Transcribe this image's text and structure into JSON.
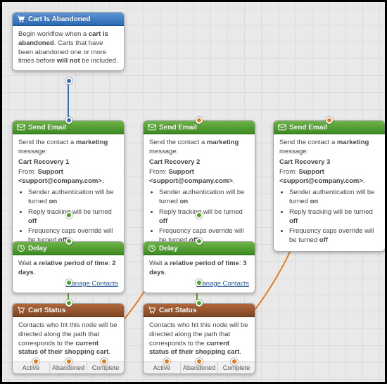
{
  "nodes": {
    "trigger": {
      "title": "Cart Is Abandoned",
      "body_parts": [
        "Begin workflow when a ",
        "cart is abandoned",
        ". Carts that have been abandoned one or more times before ",
        "will not",
        " be included."
      ]
    },
    "email1": {
      "title": "Send Email",
      "intro_pre": "Send the contact a ",
      "intro_bold": "marketing",
      "intro_post": " message:",
      "name": "Cart Recovery 1",
      "from_label": "From: ",
      "from_bold": "Support <support@company.com>",
      "bullets": [
        {
          "pre": "Sender authentication will be turned ",
          "bold": "on"
        },
        {
          "pre": "Reply tracking will be turned ",
          "bold": "off"
        },
        {
          "pre": "Frequency caps override will be turned ",
          "bold": "off"
        }
      ]
    },
    "email2": {
      "title": "Send Email",
      "intro_pre": "Send the contact a ",
      "intro_bold": "marketing",
      "intro_post": " message:",
      "name": "Cart Recovery 2",
      "from_label": "From: ",
      "from_bold": "Support <support@company.com>",
      "bullets": [
        {
          "pre": "Sender authentication will be turned ",
          "bold": "on"
        },
        {
          "pre": "Reply tracking will be turned ",
          "bold": "off"
        },
        {
          "pre": "Frequency caps override will be turned ",
          "bold": "off"
        }
      ]
    },
    "email3": {
      "title": "Send Email",
      "intro_pre": "Send the contact a ",
      "intro_bold": "marketing",
      "intro_post": " message:",
      "name": "Cart Recovery 3",
      "from_label": "From: ",
      "from_bold": "Support <support@company.com>",
      "bullets": [
        {
          "pre": "Sender authentication will be turned ",
          "bold": "on"
        },
        {
          "pre": "Reply tracking will be turned ",
          "bold": "off"
        },
        {
          "pre": "Frequency caps override will be turned ",
          "bold": "off"
        }
      ]
    },
    "delay1": {
      "title": "Delay",
      "wait_pre": "Wait ",
      "wait_bold": "a relative period of time",
      "wait_mid": ": ",
      "wait_val": "2 days",
      "manage": "Manage Contacts"
    },
    "delay2": {
      "title": "Delay",
      "wait_pre": "Wait ",
      "wait_bold": "a relative period of time",
      "wait_mid": ": ",
      "wait_val": "3 days",
      "manage": "Manage Contacts"
    },
    "status1": {
      "title": "Cart Status",
      "body_pre": "Contacts who hit this node will be directed along the path that corresponds to the ",
      "body_bold": "current status of their shopping cart",
      "branches": [
        "Active",
        "Abandoned",
        "Complete"
      ]
    },
    "status2": {
      "title": "Cart Status",
      "body_pre": "Contacts who hit this node will be directed along the path that corresponds to the ",
      "body_bold": "current status of their shopping cart",
      "branches": [
        "Active",
        "Abandoned",
        "Complete"
      ]
    }
  }
}
